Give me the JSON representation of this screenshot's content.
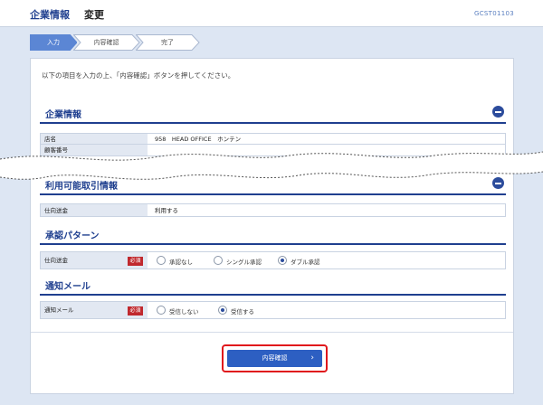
{
  "header": {
    "title": "企業情報",
    "action": "変更",
    "screen_id": "GCST01103"
  },
  "steps": [
    {
      "label": "入力",
      "active": true
    },
    {
      "label": "内容確認",
      "active": false
    },
    {
      "label": "完了",
      "active": false
    }
  ],
  "intro": "以下の項目を入力の上、「内容確認」ボタンを押してください。",
  "company": {
    "title": "企業情報",
    "rows": [
      {
        "key": "店名",
        "value": "958　HEAD OFFICE　ホンテン"
      },
      {
        "key": "顧客番号",
        "value": ""
      }
    ]
  },
  "available": {
    "title": "利用可能取引情報",
    "rows": [
      {
        "key": "仕向送金",
        "value": "利用する"
      }
    ]
  },
  "approval": {
    "title": "承認パターン",
    "key": "仕向送金",
    "required": "必須",
    "options": [
      "承認なし",
      "シングル承認",
      "ダブル承認"
    ],
    "selected": "ダブル承認"
  },
  "notify": {
    "title": "通知メール",
    "key": "通知メール",
    "required": "必須",
    "options": [
      "受信しない",
      "受信する"
    ],
    "selected": "受信する"
  },
  "confirm_button": {
    "label": "内容確認",
    "icon": "chevron-right-icon"
  },
  "colors": {
    "accent": "#1f3f8f",
    "button": "#2d5fc2",
    "required": "#c0282d",
    "highlight": "#e0171c"
  }
}
